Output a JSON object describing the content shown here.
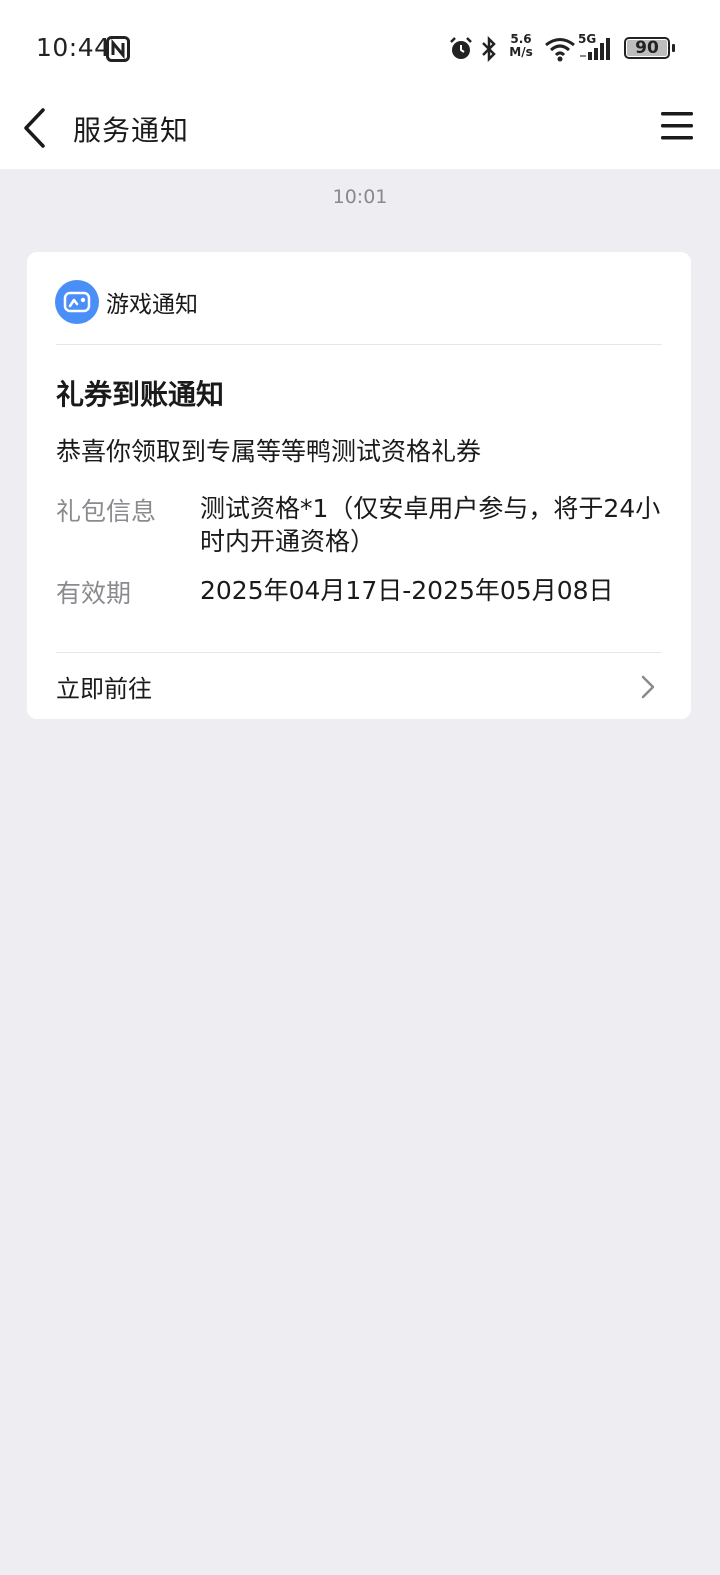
{
  "status_bar": {
    "time": "10:44",
    "speed_value": "5.6",
    "speed_unit": "M/s",
    "network": "5G",
    "battery": "90"
  },
  "nav": {
    "title": "服务通知"
  },
  "message": {
    "time": "10:01"
  },
  "card": {
    "source": "游戏通知",
    "title": "礼券到账通知",
    "description": "恭喜你领取到专属等等鸭测试资格礼券",
    "rows": [
      {
        "label": "礼包信息",
        "value": "测试资格*1（仅安卓用户参与，将于24小时内开通资格）"
      },
      {
        "label": "有效期",
        "value": "2025年04月17日-2025年05月08日"
      }
    ],
    "action_label": "立即前往"
  },
  "colors": {
    "background": "#ededf2",
    "card": "#ffffff",
    "accent_icon": "#4a8ff7",
    "label_gray": "#8b8b8f"
  }
}
